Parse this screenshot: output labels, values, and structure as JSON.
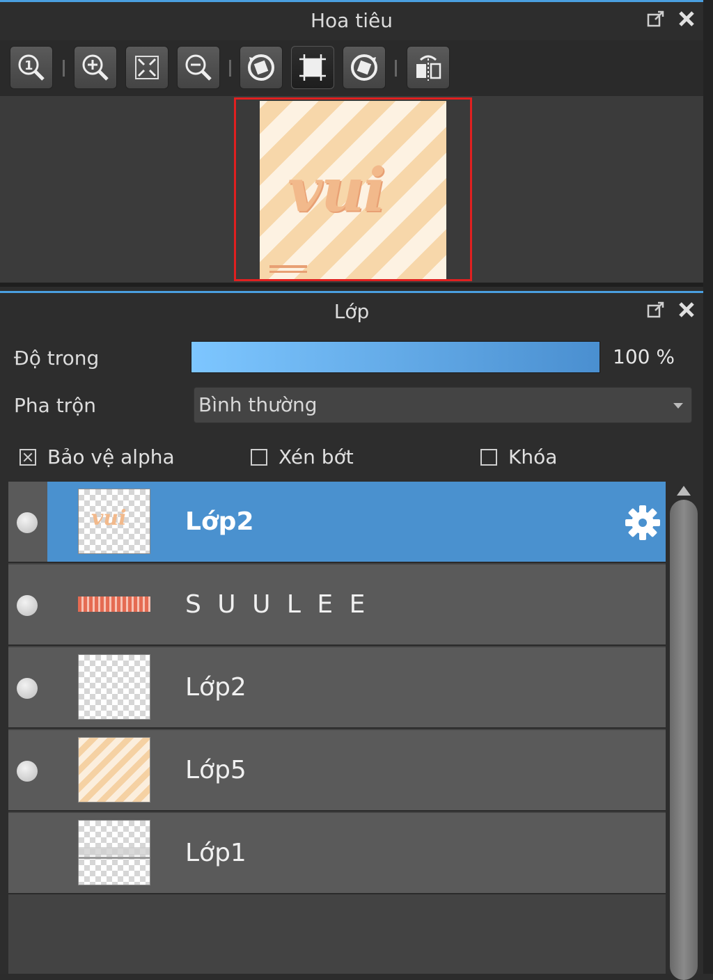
{
  "navigator": {
    "title": "Hoa tiêu",
    "toolbar": [
      "zoom-100-icon",
      "zoom-in-icon",
      "fit-screen-icon",
      "zoom-out-icon",
      "rotate-left-icon",
      "fit-canvas-icon",
      "rotate-right-icon",
      "flip-horizontal-icon"
    ],
    "active_tool": "fit-canvas-icon",
    "preview_text": "vui",
    "frame_color": "#e02020"
  },
  "layers_panel": {
    "title": "Lớp",
    "opacity_label": "Độ trong",
    "opacity_value": "100 %",
    "opacity_fraction": 1.0,
    "blend_label": "Pha trộn",
    "blend_value": "Bình thường",
    "checkboxes": [
      {
        "label": "Bảo vệ alpha",
        "checked": true
      },
      {
        "label": "Xén bớt",
        "checked": false
      },
      {
        "label": "Khóa",
        "checked": false
      }
    ],
    "layers": [
      {
        "name": "Lớp2",
        "visible": true,
        "selected": true
      },
      {
        "name": "S U U L E E",
        "visible": true,
        "selected": false
      },
      {
        "name": "Lớp2",
        "visible": true,
        "selected": false
      },
      {
        "name": "Lớp5",
        "visible": true,
        "selected": false
      },
      {
        "name": "Lớp1",
        "visible": false,
        "selected": false
      }
    ],
    "selected_color": "#4a91cf"
  }
}
